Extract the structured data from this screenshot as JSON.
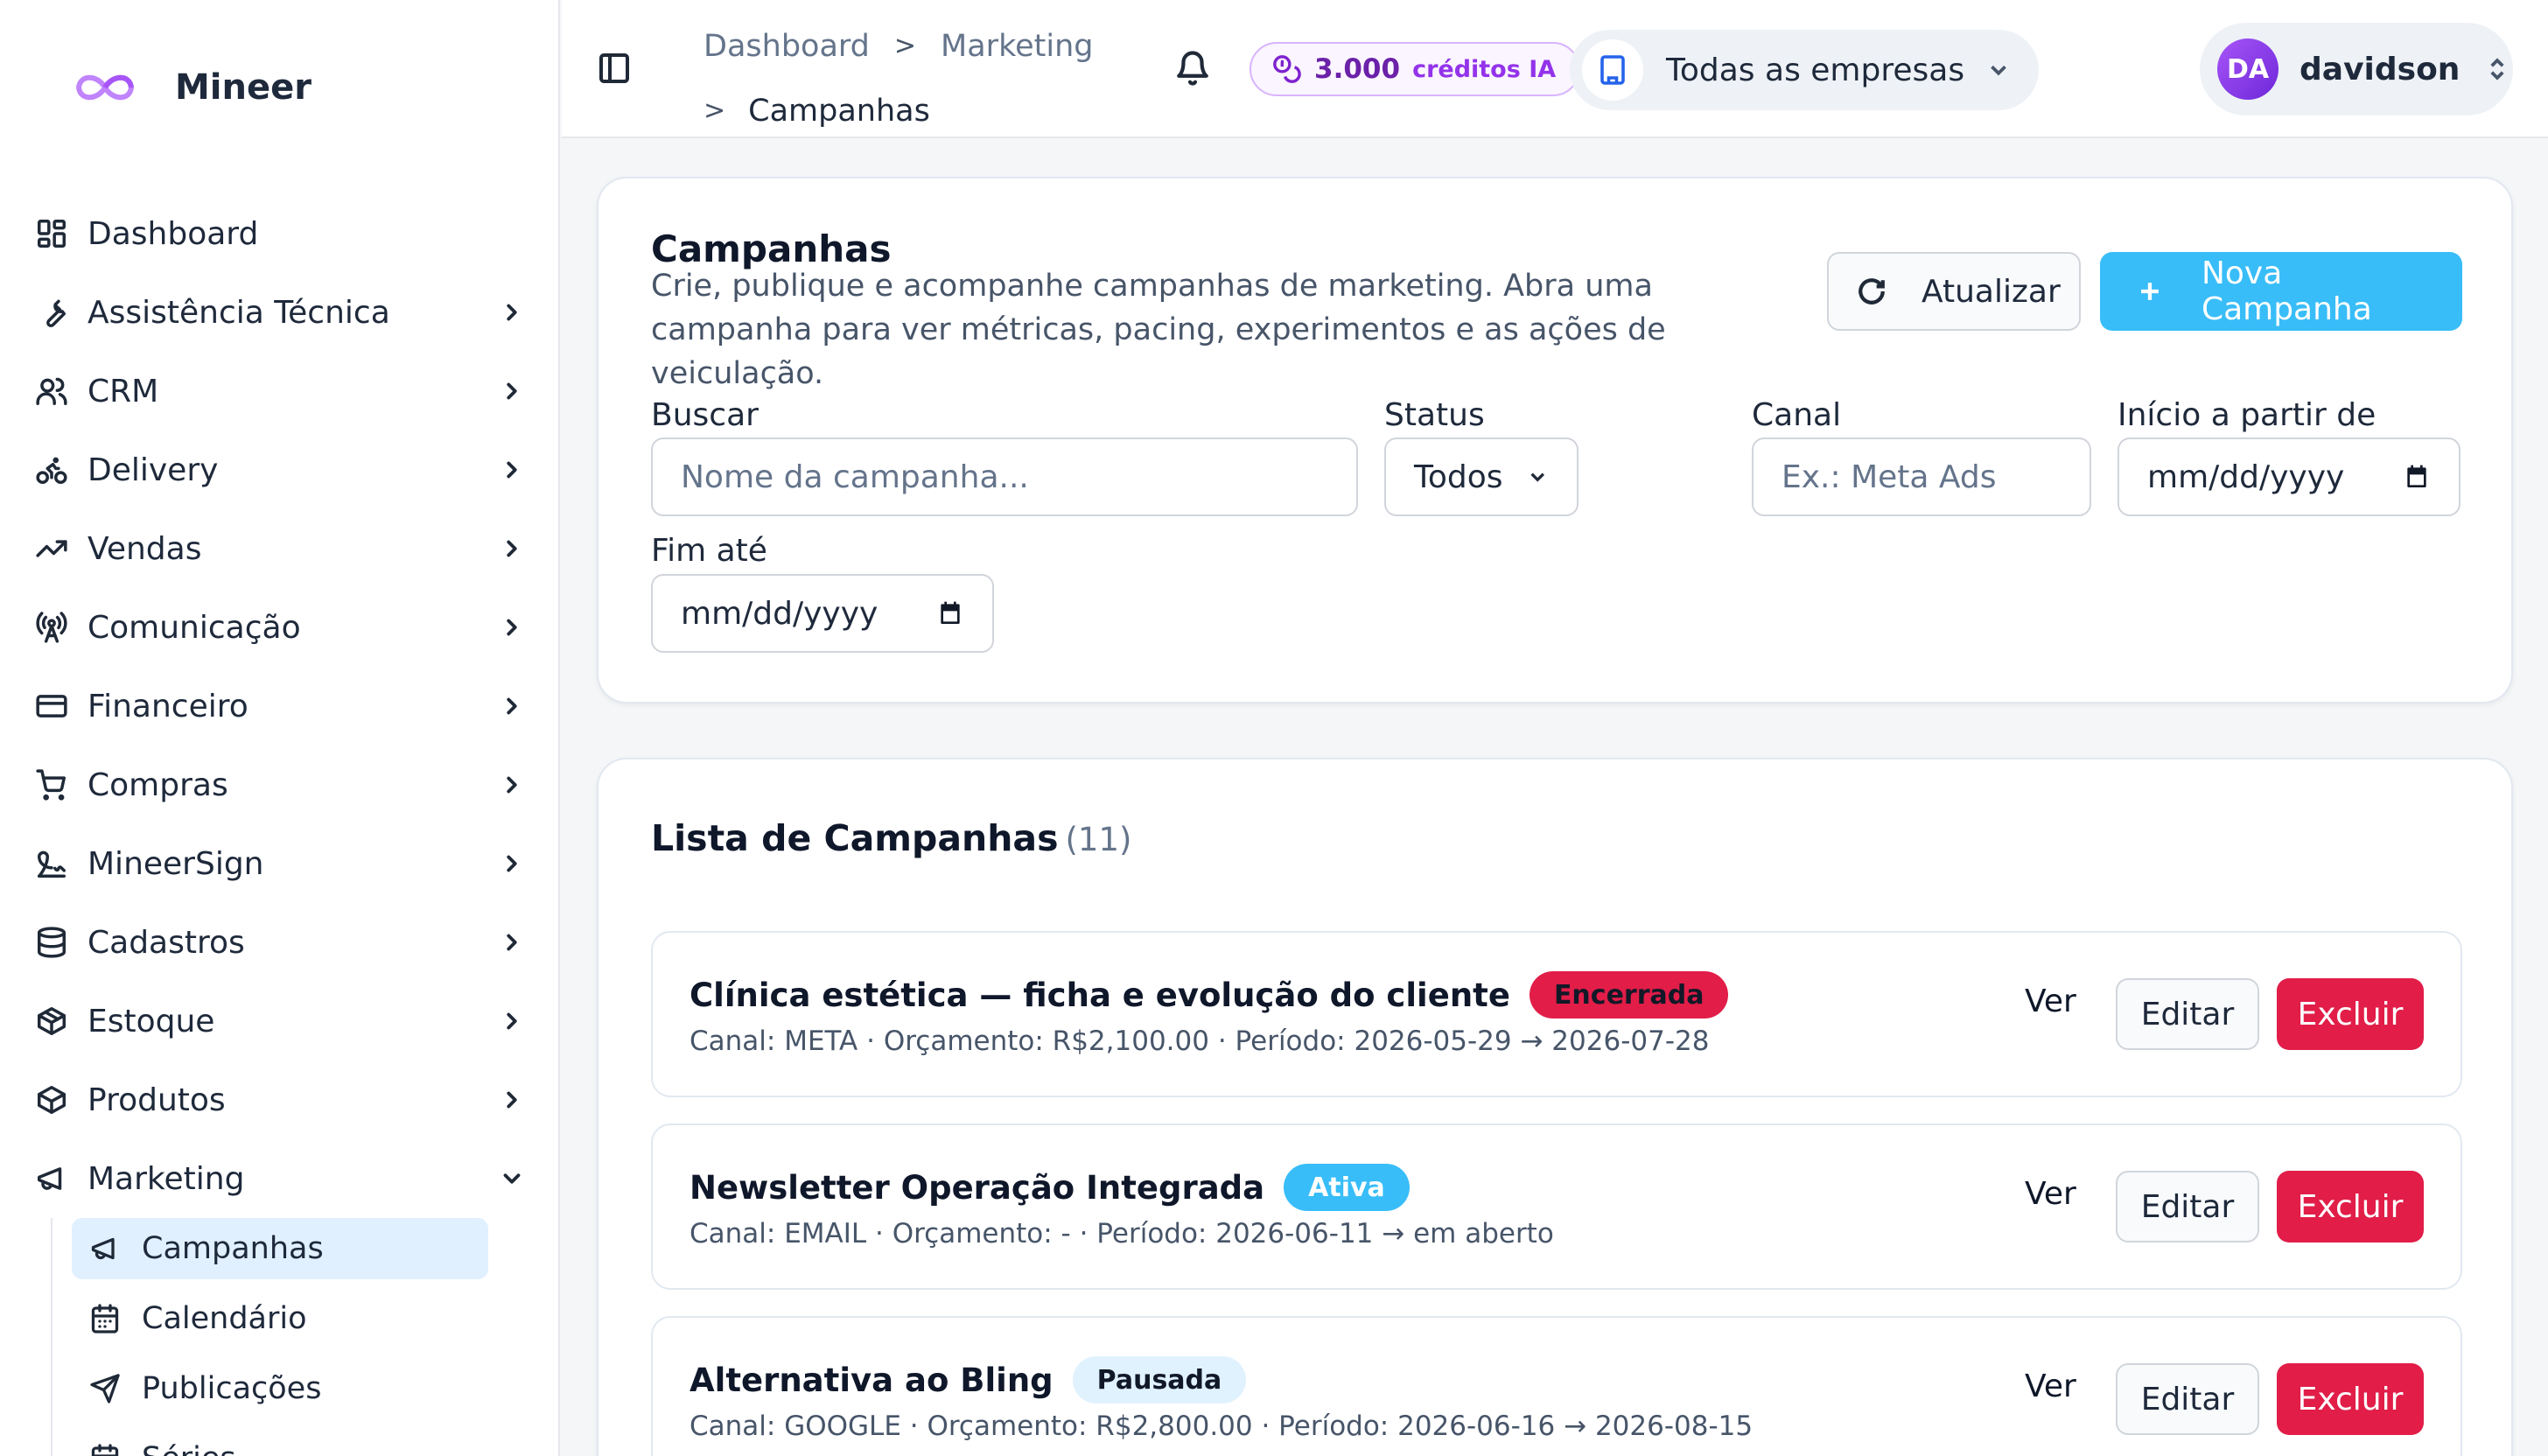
{
  "app": {
    "name": "Mineer"
  },
  "sidebar": {
    "items": [
      {
        "label": "Dashboard"
      },
      {
        "label": "Assistência Técnica"
      },
      {
        "label": "CRM"
      },
      {
        "label": "Delivery"
      },
      {
        "label": "Vendas"
      },
      {
        "label": "Comunicação"
      },
      {
        "label": "Financeiro"
      },
      {
        "label": "Compras"
      },
      {
        "label": "MineerSign"
      },
      {
        "label": "Cadastros"
      },
      {
        "label": "Estoque"
      },
      {
        "label": "Produtos"
      },
      {
        "label": "Marketing"
      }
    ],
    "marketing_sub": [
      {
        "label": "Campanhas"
      },
      {
        "label": "Calendário"
      },
      {
        "label": "Publicações"
      },
      {
        "label": "Séries"
      }
    ]
  },
  "topbar": {
    "breadcrumb": [
      "Dashboard",
      "Marketing",
      "Campanhas"
    ],
    "separator": ">",
    "credits_value": "3.000",
    "credits_label": "créditos IA",
    "company": "Todas as empresas",
    "user_initials": "DA",
    "user_name": "davidson"
  },
  "page": {
    "title": "Campanhas",
    "description": "Crie, publique e acompanhe campanhas de marketing. Abra uma campanha para ver métricas, pacing, experimentos e as ações de veiculação.",
    "refresh_label": "Atualizar",
    "new_label": "Nova Campanha"
  },
  "filters": {
    "search_label": "Buscar",
    "search_placeholder": "Nome da campanha...",
    "status_label": "Status",
    "status_value": "Todos",
    "channel_label": "Canal",
    "channel_placeholder": "Ex.: Meta Ads",
    "start_label": "Início a partir de",
    "start_placeholder": "mm/dd/yyyy",
    "end_label": "Fim até",
    "end_placeholder": "mm/dd/yyyy"
  },
  "list": {
    "title": "Lista de Campanhas",
    "count": "(11)",
    "actions": {
      "view": "Ver",
      "edit": "Editar",
      "delete": "Excluir"
    },
    "rows": [
      {
        "name": "Clínica estética — ficha e evolução do cliente",
        "status": "Encerrada",
        "meta": "Canal: META · Orçamento: R$2,100.00 · Período: 2026-05-29 → 2026-07-28"
      },
      {
        "name": "Newsletter Operação Integrada",
        "status": "Ativa",
        "meta": "Canal: EMAIL · Orçamento: - · Período: 2026-06-11 → em aberto"
      },
      {
        "name": "Alternativa ao Bling",
        "status": "Pausada",
        "meta": "Canal: GOOGLE · Orçamento: R$2,800.00 · Período: 2026-06-16 → 2026-08-15"
      }
    ]
  },
  "colors": {
    "primary": "#38bdf8",
    "danger": "#e11d48",
    "active_nav": "#e0f0fe",
    "credits_accent": "#9333ea"
  }
}
